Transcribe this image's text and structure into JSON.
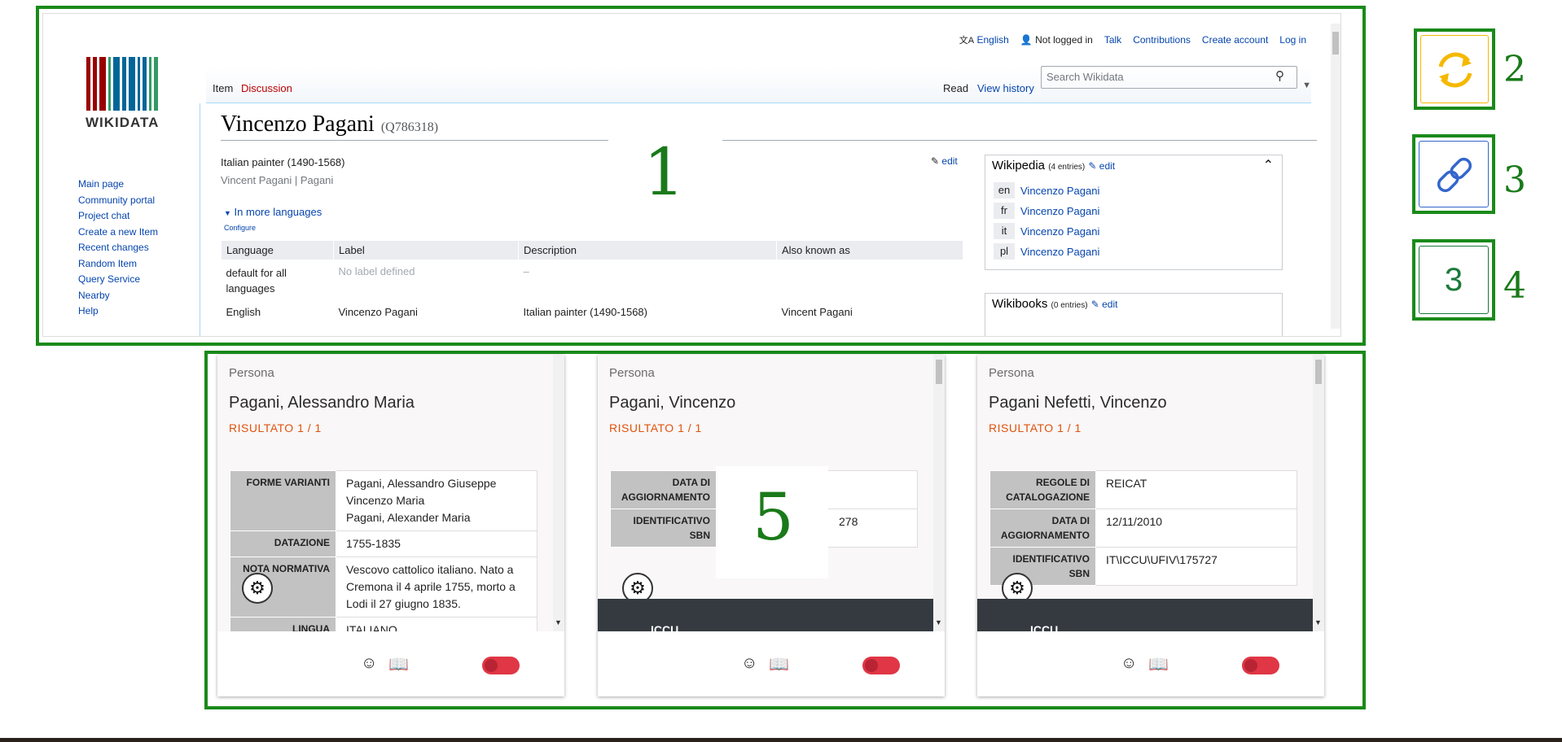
{
  "wikidata": {
    "logo_text": "WIKIDATA",
    "user_bar": {
      "language": "English",
      "status": "Not logged in",
      "talk": "Talk",
      "contributions": "Contributions",
      "create_account": "Create account",
      "log_in": "Log in"
    },
    "tabs": {
      "item": "Item",
      "discussion": "Discussion",
      "read": "Read",
      "view_history": "View history"
    },
    "search_placeholder": "Search Wikidata",
    "sidebar": [
      "Main page",
      "Community portal",
      "Project chat",
      "Create a new Item",
      "Recent changes",
      "Random Item",
      "Query Service",
      "Nearby",
      "Help"
    ],
    "title": "Vincenzo Pagani",
    "qid": "(Q786318)",
    "description": "Italian painter (1490-1568)",
    "aliases": "Vincent Pagani | Pagani",
    "edit": "edit",
    "more_languages": "In more languages",
    "configure": "Configure",
    "lang_table": {
      "headers": [
        "Language",
        "Label",
        "Description",
        "Also known as"
      ],
      "rows": [
        [
          "default for all languages",
          "No label defined",
          "–",
          ""
        ],
        [
          "English",
          "Vincenzo Pagani",
          "Italian painter (1490-1568)",
          "Vincent Pagani"
        ]
      ]
    },
    "wikipedia": {
      "title": "Wikipedia",
      "count": "(4 entries)",
      "edit": "edit",
      "links": [
        {
          "code": "en",
          "text": "Vincenzo Pagani"
        },
        {
          "code": "fr",
          "text": "Vincenzo Pagani"
        },
        {
          "code": "it",
          "text": "Vincenzo Pagani"
        },
        {
          "code": "pl",
          "text": "Vincenzo Pagani"
        }
      ]
    },
    "wikibooks": {
      "title": "Wikibooks",
      "count": "(0 entries)",
      "edit": "edit"
    }
  },
  "cards": [
    {
      "type": "Persona",
      "name": "Pagani, Alessandro Maria",
      "result": "RISULTATO 1 / 1",
      "rows": [
        {
          "k": "FORME VARIANTI",
          "v": "Pagani, Alessandro Giuseppe Vincenzo Maria\nPagani, Alexander Maria"
        },
        {
          "k": "DATAZIONE",
          "v": "1755-1835"
        },
        {
          "k": "NOTA NORMATIVA",
          "v": "Vescovo cattolico italiano. Nato a Cremona il 4 aprile 1755, morto a Lodi il 27 giugno 1835."
        },
        {
          "k": "LINGUA",
          "v": "ITALIANO"
        }
      ]
    },
    {
      "type": "Persona",
      "name": "Pagani, Vincenzo",
      "result": "RISULTATO 1 / 1",
      "rows": [
        {
          "k": "DATA DI AGGIORNAMENTO",
          "v": ""
        },
        {
          "k": "IDENTIFICATIVO SBN",
          "v": "278"
        }
      ],
      "footer_bar": "ICCU"
    },
    {
      "type": "Persona",
      "name": "Pagani Nefetti, Vincenzo",
      "result": "RISULTATO 1 / 1",
      "rows": [
        {
          "k": "REGOLE DI CATALOGAZIONE",
          "v": "REICAT"
        },
        {
          "k": "DATA DI AGGIORNAMENTO",
          "v": "12/11/2010"
        },
        {
          "k": "IDENTIFICATIVO SBN",
          "v": "IT\\ICCU\\UFIV\\175727"
        }
      ],
      "footer_bar": "ICCU"
    }
  ],
  "labels": {
    "l1": "1",
    "l2": "2",
    "l3": "3",
    "l4": "4",
    "l5": "5",
    "badge_number": "3"
  },
  "colors": {
    "box_green": "#1a8a1a",
    "accent_orange": "#e0520d",
    "toggle_red": "#e03645",
    "sync_yellow": "#f5b800",
    "link_blue": "#3366cc"
  }
}
